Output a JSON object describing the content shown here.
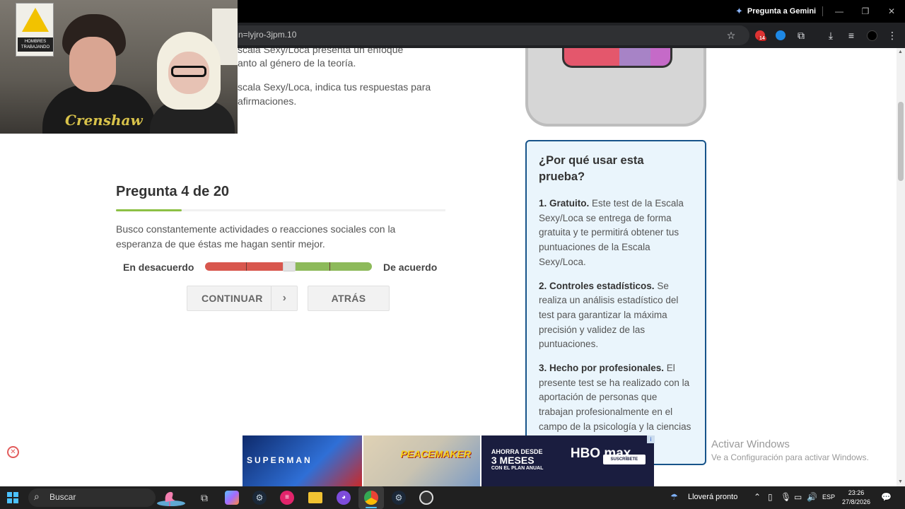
{
  "titlebar": {
    "gemini_label": "Pregunta a Gemini",
    "minimize": "—",
    "restore": "❐",
    "close": "✕"
  },
  "toolbar": {
    "url": "n=lyjro-3jpm.10",
    "extension_badge": "14"
  },
  "webcam": {
    "sign_text": "HOMBRES TRABAJANDO",
    "shirt_text": "Crenshaw"
  },
  "intro": {
    "line1": "scala Sexy/Loca presenta un enfoque",
    "line2": "anto al género de la teoría.",
    "line3": "scala Sexy/Loca, indica tus respuestas para",
    "line4": "afirmaciones."
  },
  "question": {
    "title": "Pregunta 4 de 20",
    "progress": 0.2,
    "text": "Busco constantemente actividades o reacciones sociales con la esperanza de que éstas me hagan sentir mejor.",
    "label_left": "En desacuerdo",
    "label_right": "De acuerdo",
    "slider_value": 0.5,
    "continue_label": "CONTINUAR",
    "continue_arrow": "›",
    "back_label": "ATRÁS"
  },
  "whybox": {
    "title": "¿Por qué usar esta prueba?",
    "items": [
      {
        "head": "1. Gratuito.",
        "body": " Este test de la Escala Sexy/Loca se entrega de forma gratuita y te permitirá obtener tus puntuaciones de la Escala Sexy/Loca."
      },
      {
        "head": "2. Controles estadísticos.",
        "body": " Se realiza un análisis estadístico del test para garantizar la máxima precisión y validez de las puntuaciones."
      },
      {
        "head": "3. Hecho por profesionales.",
        "body": " El presente test se ha realizado con la aportación de personas que trabajan profesionalmente en el campo de la psicología y la ciencias"
      }
    ]
  },
  "ad": {
    "superman": "SUPERMAN",
    "peacemaker": "PEACEMAKER",
    "hbo_line1": "AHORRA DESDE",
    "hbo_line2": "3 MESES",
    "hbo_line3": "CON EL PLAN ANUAL",
    "hbo_logo": "HBO max",
    "hbo_cta": "SUSCRÍBETE AHORA",
    "close": "✕",
    "info": "i"
  },
  "watermark": {
    "line1": "Activar Windows",
    "line2": "Ve a Configuración para activar Windows."
  },
  "taskbar": {
    "search": "Buscar",
    "weather": "Lloverá pronto",
    "lang": "ESP",
    "time": "23:26",
    "date": "27/8/2026"
  },
  "colors": {
    "accent_green": "#8dc045",
    "disagree_red": "#d8574e",
    "agree_green": "#8dba5a",
    "box_border": "#17548a",
    "box_bg": "#eaf5fc"
  }
}
